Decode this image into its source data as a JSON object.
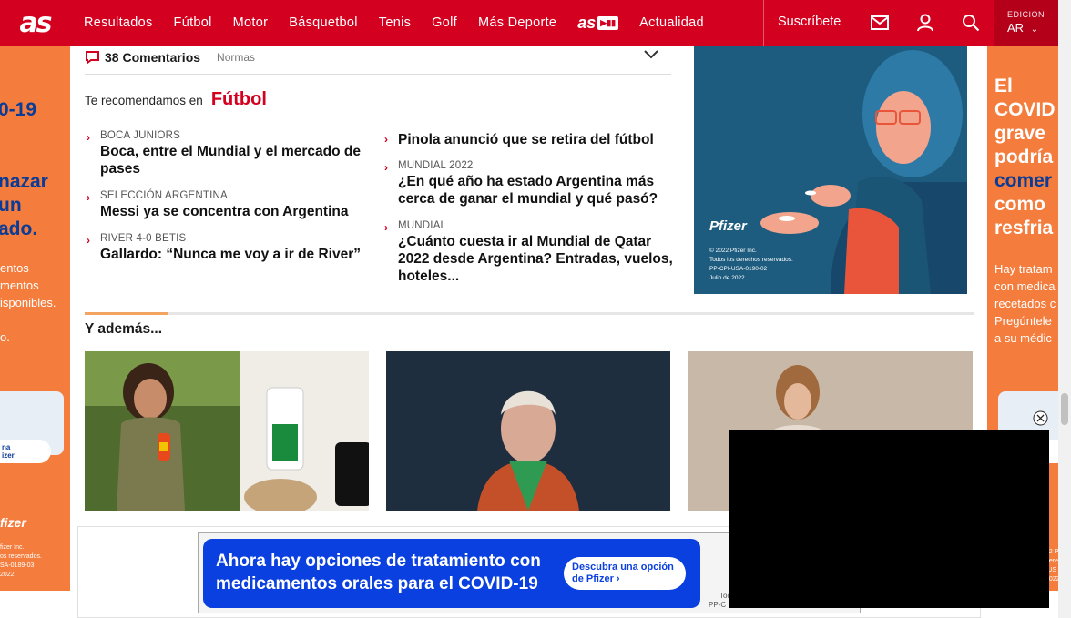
{
  "header": {
    "logo": "as",
    "nav": [
      "Resultados",
      "Fútbol",
      "Motor",
      "Básquetbol",
      "Tenis",
      "Golf",
      "Más Deporte"
    ],
    "asplay_logo": "as",
    "nav_last": "Actualidad",
    "subscribe": "Suscríbete",
    "edition_label": "EDICION",
    "edition_value": "AR",
    "brand_color": "#d4001f"
  },
  "comments": {
    "count_label": "38 Comentarios",
    "rules_label": "Normas"
  },
  "recommend": {
    "label": "Te recomendamos en",
    "section": "Fútbol",
    "left": [
      {
        "kicker": "BOCA JUNIORS",
        "headline": "Boca, entre el Mundial y el mercado de pases"
      },
      {
        "kicker": "SELECCIÓN ARGENTINA",
        "headline": "Messi ya se concentra con Argentina"
      },
      {
        "kicker": "RIVER 4-0 BETIS",
        "headline": "Gallardo: “Nunca me voy a ir de River”"
      }
    ],
    "right": [
      {
        "kicker": "",
        "headline": "Pinola anunció que se retira del fútbol"
      },
      {
        "kicker": "MUNDIAL 2022",
        "headline": "¿En qué año ha estado Argentina más cerca de ganar el mundial y qué pasó?"
      },
      {
        "kicker": "MUNDIAL",
        "headline": "¿Cuánto cuesta ir al Mundial de Qatar 2022 desde Argentina? Entradas, vuelos, hoteles..."
      }
    ]
  },
  "ad_main": {
    "brand": "Pfizer",
    "legal": [
      "© 2022 Pfizer Inc.",
      "Todos los derechos reservados.",
      "PP-CPI-USA-0190-02",
      "Julio de 2022"
    ]
  },
  "left_ad": {
    "big": [
      "0-19",
      "",
      "",
      "nazar",
      "un",
      "ado."
    ],
    "small": [
      "entos",
      "mentos",
      "isponibles.",
      "",
      "o."
    ],
    "cta": [
      "na",
      "izer"
    ],
    "brand": "fizer",
    "legal": [
      "fizer Inc.",
      "os reservados.",
      "SA-0189-03",
      "2022"
    ]
  },
  "right_ad": {
    "head": [
      "El",
      "COVID",
      "grave",
      "podría",
      "comer",
      "como",
      "resfria"
    ],
    "small": [
      "Hay tratam",
      "con medica",
      "recetados c",
      "Pregúntele",
      "a su médic"
    ],
    "cta": [
      "a u",
      "e P"
    ],
    "legal": [
      "22 P",
      "dere",
      "-US",
      "2022"
    ]
  },
  "also": {
    "title": "Y además..."
  },
  "bottom_ad": {
    "line1": "Ahora hay opciones de tratamiento con",
    "line2": "medicamentos orales para el COVID-19",
    "cta_line1": "Descubra una opción",
    "cta_line2": "de Pfizer",
    "legal_line1": "Tod",
    "legal_line2": "PP-C"
  }
}
